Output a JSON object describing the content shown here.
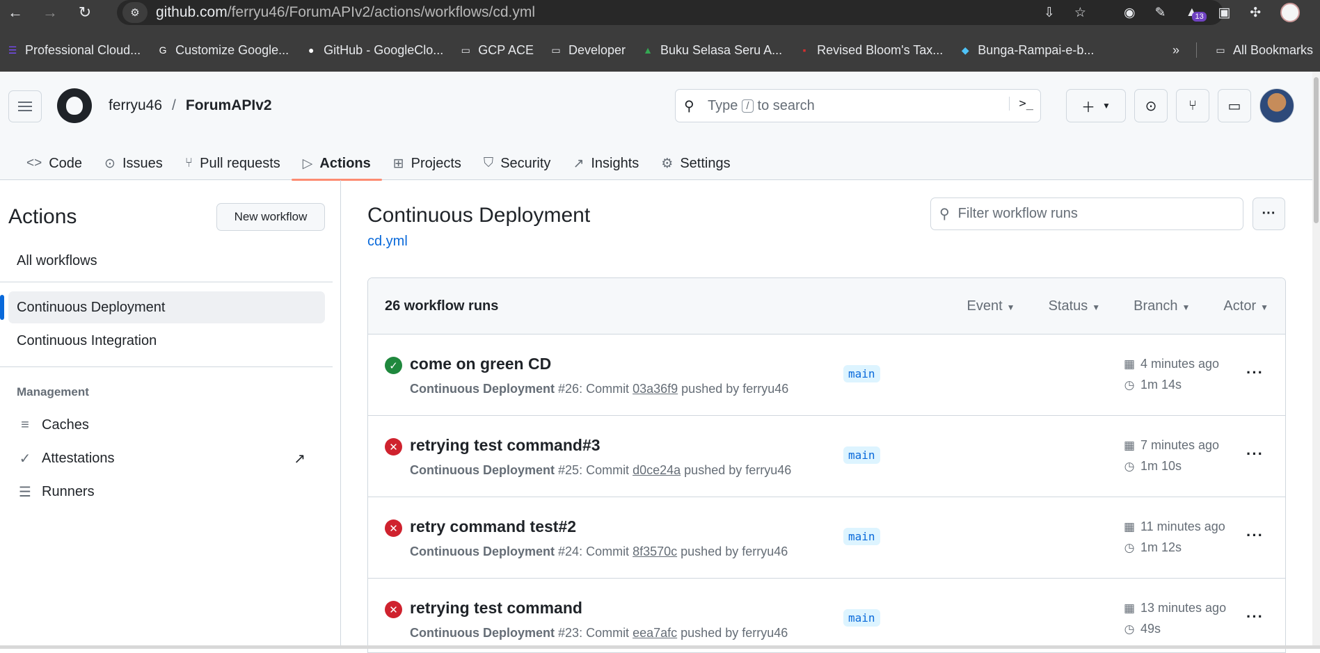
{
  "browser": {
    "url_host": "github.com",
    "url_path": "/ferryu46/ForumAPIv2/actions/workflows/cd.yml",
    "ext_badge": "13",
    "bookmarks": [
      {
        "label": "Professional Cloud...",
        "icon": "book-icon",
        "color": "#7c4dff"
      },
      {
        "label": "Customize Google...",
        "icon": "google-icon",
        "color": "#ffffff"
      },
      {
        "label": "GitHub - GoogleClo...",
        "icon": "github-icon",
        "color": "#ffffff"
      },
      {
        "label": "GCP ACE",
        "icon": "folder-icon",
        "color": "#e8eaed"
      },
      {
        "label": "Developer",
        "icon": "folder-icon",
        "color": "#e8eaed"
      },
      {
        "label": "Buku Selasa Seru A...",
        "icon": "drive-icon",
        "color": "#34a853"
      },
      {
        "label": "Revised Bloom's Tax...",
        "icon": "pdf-icon",
        "color": "#d32f2f"
      },
      {
        "label": "Bunga-Rampai-e-b...",
        "icon": "grad-icon",
        "color": "#4fc3f7"
      }
    ],
    "more_bookmarks": "»",
    "all_bookmarks": "All Bookmarks"
  },
  "header": {
    "owner": "ferryu46",
    "slash": "/",
    "repo": "ForumAPIv2",
    "search_prefix": "Type",
    "search_key": "/",
    "search_suffix": "to search"
  },
  "tabs": [
    {
      "label": "Code",
      "icon": "code-icon",
      "glyph": "<>"
    },
    {
      "label": "Issues",
      "icon": "issue-icon",
      "glyph": "⊙"
    },
    {
      "label": "Pull requests",
      "icon": "pull-request-icon",
      "glyph": "⑂"
    },
    {
      "label": "Actions",
      "icon": "play-icon",
      "glyph": "▷"
    },
    {
      "label": "Projects",
      "icon": "table-icon",
      "glyph": "⊞"
    },
    {
      "label": "Security",
      "icon": "shield-icon",
      "glyph": "⛉"
    },
    {
      "label": "Insights",
      "icon": "graph-icon",
      "glyph": "↗"
    },
    {
      "label": "Settings",
      "icon": "gear-icon",
      "glyph": "⚙"
    }
  ],
  "sidebar": {
    "title": "Actions",
    "new_workflow": "New workflow",
    "all_workflows": "All workflows",
    "workflows": [
      "Continuous Deployment",
      "Continuous Integration"
    ],
    "management_label": "Management",
    "management": [
      {
        "label": "Caches",
        "icon": "database-icon",
        "glyph": "≡"
      },
      {
        "label": "Attestations",
        "icon": "verified-icon",
        "glyph": "✓"
      },
      {
        "label": "Runners",
        "icon": "server-icon",
        "glyph": "☰"
      }
    ],
    "external_arrow": "↗"
  },
  "main": {
    "title": "Continuous Deployment",
    "file": "cd.yml",
    "filter_placeholder": "Filter workflow runs",
    "runs_count": "26 workflow runs",
    "filters": [
      "Event",
      "Status",
      "Branch",
      "Actor"
    ],
    "runs": [
      {
        "status": "success",
        "title": "come on green CD",
        "workflow": "Continuous Deployment",
        "number": "#26",
        "commit_label": ": Commit",
        "sha": "03a36f9",
        "pushed": "pushed by ferryu46",
        "branch": "main",
        "when": "4 minutes ago",
        "duration": "1m 14s"
      },
      {
        "status": "failure",
        "title": "retrying test command#3",
        "workflow": "Continuous Deployment",
        "number": "#25",
        "commit_label": ": Commit",
        "sha": "d0ce24a",
        "pushed": "pushed by ferryu46",
        "branch": "main",
        "when": "7 minutes ago",
        "duration": "1m 10s"
      },
      {
        "status": "failure",
        "title": "retry command test#2",
        "workflow": "Continuous Deployment",
        "number": "#24",
        "commit_label": ": Commit",
        "sha": "8f3570c",
        "pushed": "pushed by ferryu46",
        "branch": "main",
        "when": "11 minutes ago",
        "duration": "1m 12s"
      },
      {
        "status": "failure",
        "title": "retrying test command",
        "workflow": "Continuous Deployment",
        "number": "#23",
        "commit_label": ": Commit",
        "sha": "eea7afc",
        "pushed": "pushed by ferryu46",
        "branch": "main",
        "when": "13 minutes ago",
        "duration": "49s"
      }
    ]
  },
  "colors": {
    "accent_blue": "#0969da",
    "success_green": "#1f883d",
    "failure_red": "#cf222e",
    "tab_underline": "#fd8c73"
  }
}
